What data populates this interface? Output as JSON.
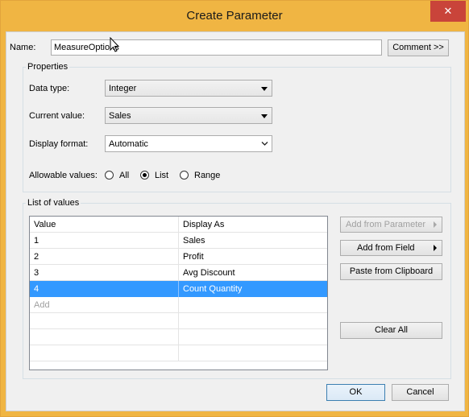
{
  "window": {
    "title": "Create Parameter",
    "close_glyph": "✕"
  },
  "name_row": {
    "label": "Name:",
    "value": "MeasureOptions",
    "comment_button": "Comment >>"
  },
  "properties": {
    "title": "Properties",
    "data_type_label": "Data type:",
    "data_type_value": "Integer",
    "current_value_label": "Current value:",
    "current_value_value": "Sales",
    "display_format_label": "Display format:",
    "display_format_value": "Automatic",
    "allowable_label": "Allowable values:",
    "allowable_options": [
      {
        "label": "All",
        "selected": false
      },
      {
        "label": "List",
        "selected": true
      },
      {
        "label": "Range",
        "selected": false
      }
    ]
  },
  "list_of_values": {
    "title": "List of values",
    "columns": [
      "Value",
      "Display As"
    ],
    "rows": [
      {
        "value": "1",
        "display": "Sales"
      },
      {
        "value": "2",
        "display": "Profit"
      },
      {
        "value": "3",
        "display": "Avg Discount"
      },
      {
        "value": "4",
        "display": "Count Quantity"
      }
    ],
    "add_placeholder": "Add",
    "add_from_parameter": "Add from Parameter",
    "add_from_field": "Add from Field",
    "paste_from_clipboard": "Paste from Clipboard",
    "clear_all": "Clear All"
  },
  "footer": {
    "ok": "OK",
    "cancel": "Cancel"
  },
  "colors": {
    "title_bar": "#f0b543",
    "close_button": "#c9443a",
    "selection": "#3399ff"
  }
}
